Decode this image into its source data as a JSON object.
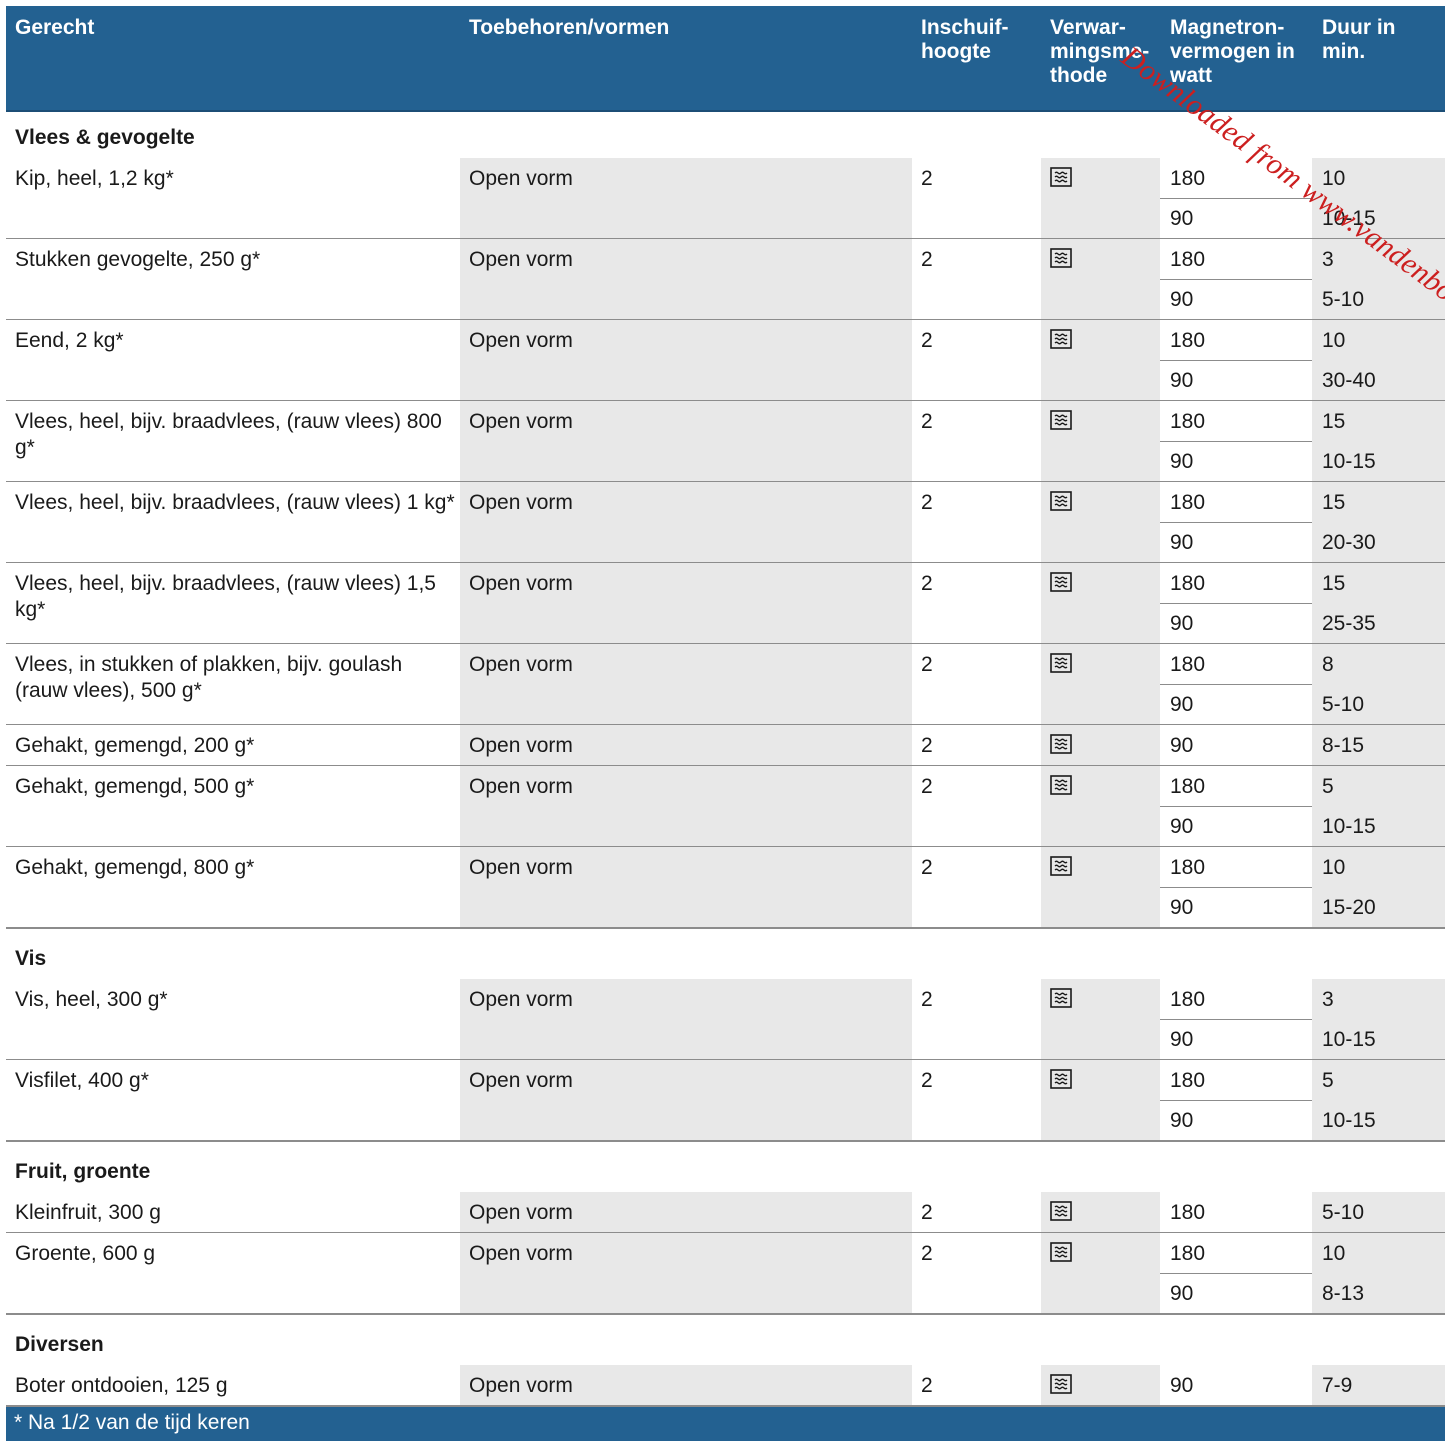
{
  "header": {
    "dish": "Gerecht",
    "accessories": "Toebehoren/vormen",
    "shelf": "Inschuif-\nhoogte",
    "method": "Verwar-\nmingsme-\nthode",
    "power": "Magnetron-\nvermogen in\nwatt",
    "duration": "Duur in\nmin."
  },
  "method_icon": "microwave-icon",
  "sections": [
    {
      "title": "Vlees & gevogelte",
      "rows": [
        {
          "dish": "Kip, heel, 1,2 kg*",
          "accessory": "Open vorm",
          "shelf": "2",
          "steps": [
            {
              "watt": "180",
              "min": "10"
            },
            {
              "watt": "90",
              "min": "10-15"
            }
          ]
        },
        {
          "dish": "Stukken gevogelte, 250 g*",
          "accessory": "Open vorm",
          "shelf": "2",
          "steps": [
            {
              "watt": "180",
              "min": "3"
            },
            {
              "watt": "90",
              "min": "5-10"
            }
          ]
        },
        {
          "dish": "Eend, 2 kg*",
          "accessory": "Open vorm",
          "shelf": "2",
          "steps": [
            {
              "watt": "180",
              "min": "10"
            },
            {
              "watt": "90",
              "min": "30-40"
            }
          ]
        },
        {
          "dish": "Vlees, heel, bijv. braadvlees, (rauw vlees) 800 g*",
          "accessory": "Open vorm",
          "shelf": "2",
          "steps": [
            {
              "watt": "180",
              "min": "15"
            },
            {
              "watt": "90",
              "min": "10-15"
            }
          ]
        },
        {
          "dish": "Vlees, heel, bijv. braadvlees, (rauw vlees) 1 kg*",
          "accessory": "Open vorm",
          "shelf": "2",
          "steps": [
            {
              "watt": "180",
              "min": "15"
            },
            {
              "watt": "90",
              "min": "20-30"
            }
          ]
        },
        {
          "dish": "Vlees, heel, bijv. braadvlees, (rauw vlees) 1,5 kg*",
          "accessory": "Open vorm",
          "shelf": "2",
          "steps": [
            {
              "watt": "180",
              "min": "15"
            },
            {
              "watt": "90",
              "min": "25-35"
            }
          ]
        },
        {
          "dish": "Vlees, in stukken of plakken, bijv. goulash (rauw vlees), 500 g*",
          "accessory": "Open vorm",
          "shelf": "2",
          "steps": [
            {
              "watt": "180",
              "min": "8"
            },
            {
              "watt": "90",
              "min": "5-10"
            }
          ]
        },
        {
          "dish": "Gehakt, gemengd, 200 g*",
          "accessory": "Open vorm",
          "shelf": "2",
          "steps": [
            {
              "watt": "90",
              "min": "8-15"
            }
          ]
        },
        {
          "dish": "Gehakt, gemengd, 500 g*",
          "accessory": "Open vorm",
          "shelf": "2",
          "steps": [
            {
              "watt": "180",
              "min": "5"
            },
            {
              "watt": "90",
              "min": "10-15"
            }
          ]
        },
        {
          "dish": "Gehakt, gemengd, 800 g*",
          "accessory": "Open vorm",
          "shelf": "2",
          "steps": [
            {
              "watt": "180",
              "min": "10"
            },
            {
              "watt": "90",
              "min": "15-20"
            }
          ]
        }
      ]
    },
    {
      "title": "Vis",
      "rows": [
        {
          "dish": "Vis, heel, 300 g*",
          "accessory": "Open vorm",
          "shelf": "2",
          "steps": [
            {
              "watt": "180",
              "min": "3"
            },
            {
              "watt": "90",
              "min": "10-15"
            }
          ]
        },
        {
          "dish": "Visfilet, 400 g*",
          "accessory": "Open vorm",
          "shelf": "2",
          "steps": [
            {
              "watt": "180",
              "min": "5"
            },
            {
              "watt": "90",
              "min": "10-15"
            }
          ]
        }
      ]
    },
    {
      "title": "Fruit, groente",
      "rows": [
        {
          "dish": "Kleinfruit, 300 g",
          "accessory": "Open vorm",
          "shelf": "2",
          "steps": [
            {
              "watt": "180",
              "min": "5-10"
            }
          ]
        },
        {
          "dish": "Groente, 600 g",
          "accessory": "Open vorm",
          "shelf": "2",
          "steps": [
            {
              "watt": "180",
              "min": "10"
            },
            {
              "watt": "90",
              "min": "8-13"
            }
          ]
        }
      ]
    },
    {
      "title": "Diversen",
      "rows": [
        {
          "dish": "Boter ontdooien, 125 g",
          "accessory": "Open vorm",
          "shelf": "2",
          "steps": [
            {
              "watt": "90",
              "min": "7-9"
            }
          ]
        }
      ]
    }
  ],
  "footnote": "*  Na 1/2 van de tijd keren",
  "watermark": "Downloaded from www.vandenborre.be",
  "colors": {
    "header_bg": "#236191",
    "shade": "#e8e8e8",
    "watermark": "#cc1f1f"
  }
}
